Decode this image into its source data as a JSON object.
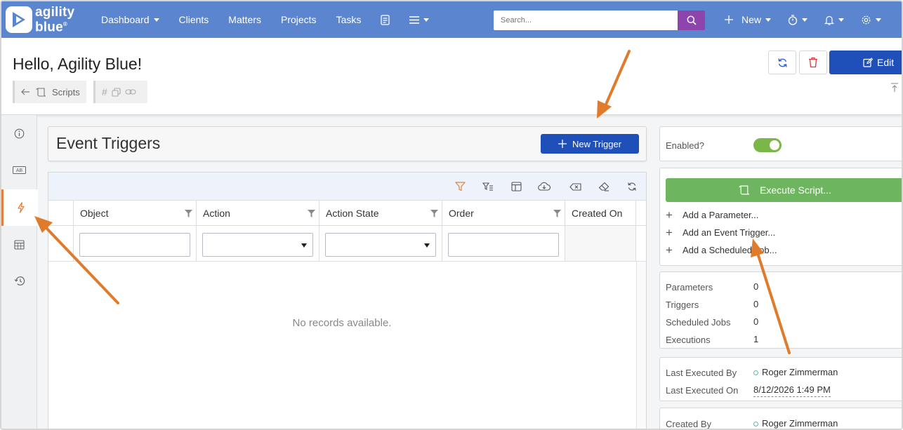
{
  "app": {
    "brand_line1": "agility",
    "brand_line2": "blue",
    "brand_mark": "®"
  },
  "nav": {
    "items": [
      {
        "label": "Dashboard",
        "has_caret": true
      },
      {
        "label": "Clients",
        "has_caret": false
      },
      {
        "label": "Matters",
        "has_caret": false
      },
      {
        "label": "Projects",
        "has_caret": false
      },
      {
        "label": "Tasks",
        "has_caret": false
      }
    ],
    "search_placeholder": "Search...",
    "new_label": "New"
  },
  "header": {
    "greeting": "Hello, Agility Blue!",
    "breadcrumb_label": "Scripts",
    "edit_label": "Edit"
  },
  "main": {
    "section_title": "Event Triggers",
    "new_trigger_label": "New Trigger",
    "columns": [
      "Object",
      "Action",
      "Action State",
      "Order",
      "Created On"
    ],
    "empty_message": "No records available."
  },
  "side": {
    "enabled_label": "Enabled?",
    "enabled": true,
    "execute_label": "Execute Script...",
    "actions": [
      "Add a Parameter...",
      "Add an Event Trigger...",
      "Add a Scheduled Job..."
    ],
    "stats": [
      {
        "label": "Parameters",
        "value": "0"
      },
      {
        "label": "Triggers",
        "value": "0"
      },
      {
        "label": "Scheduled Jobs",
        "value": "0"
      },
      {
        "label": "Executions",
        "value": "1"
      }
    ],
    "last_executed_by_label": "Last Executed By",
    "last_executed_by": "Roger Zimmerman",
    "last_executed_on_label": "Last Executed On",
    "last_executed_on": "8/12/2026 1:49 PM",
    "created_by_label": "Created By",
    "created_by": "Roger Zimmerman"
  },
  "colors": {
    "nav_bg": "#5b86cf",
    "primary_button": "#1f4fb8",
    "execute_button": "#6eb55f",
    "toggle_on": "#7ab648",
    "active_tab_accent": "#e0823d",
    "annotation_arrow": "#e07b2c",
    "search_button": "#8e44ad"
  },
  "icons": [
    "agility-blue-logo-icon",
    "search-icon",
    "plus-icon",
    "timer-icon",
    "bell-icon",
    "gear-icon",
    "document-icon",
    "menu-icon",
    "refresh-icon",
    "trash-icon",
    "edit-icon",
    "back-arrow-icon",
    "script-icon",
    "hash-icon",
    "copy-icon",
    "link-icon",
    "info-icon",
    "ab-icon",
    "lightning-icon",
    "calendar-icon",
    "history-icon",
    "filter-icon",
    "filter-list-icon",
    "columns-icon",
    "download-icon",
    "clear-icon",
    "eraser-icon",
    "pin-icon"
  ]
}
